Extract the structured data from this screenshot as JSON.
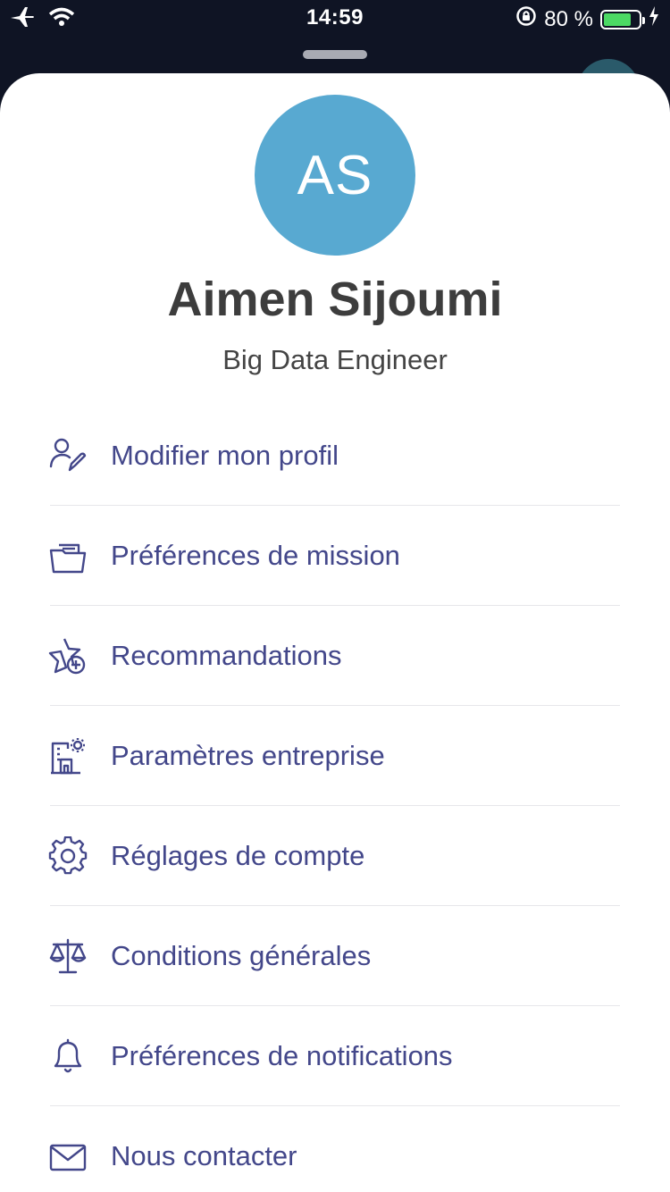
{
  "status_bar": {
    "time": "14:59",
    "battery_text": "80 %",
    "battery_level": 0.8,
    "battery_color": "#4cd964"
  },
  "profile": {
    "initials": "AS",
    "avatar_color": "#58a9d1",
    "name": "Aimen Sijoumi",
    "role": "Big Data Engineer"
  },
  "menu": {
    "accent_color": "#43478a",
    "items": [
      {
        "label": "Modifier mon profil",
        "icon": "edit-user-icon"
      },
      {
        "label": "Préférences de mission",
        "icon": "folder-icon"
      },
      {
        "label": "Recommandations",
        "icon": "star-plus-icon"
      },
      {
        "label": "Paramètres entreprise",
        "icon": "building-icon"
      },
      {
        "label": "Réglages de compte",
        "icon": "gear-icon"
      },
      {
        "label": "Conditions générales",
        "icon": "scales-icon"
      },
      {
        "label": "Préférences de notifications",
        "icon": "bell-icon"
      },
      {
        "label": "Nous contacter",
        "icon": "envelope-icon"
      }
    ]
  }
}
